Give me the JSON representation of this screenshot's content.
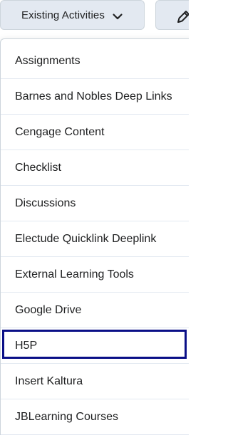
{
  "toolbar": {
    "existing_activities_label": "Existing Activities",
    "existing_activities_icon": "chevron-down-icon",
    "second_button_icon": "pencil-icon"
  },
  "menu": {
    "focused_item": "H5P",
    "items": [
      {
        "label": "Assignments"
      },
      {
        "label": "Barnes and Nobles Deep Links"
      },
      {
        "label": "Cengage Content"
      },
      {
        "label": "Checklist"
      },
      {
        "label": "Discussions"
      },
      {
        "label": "Electude Quicklink Deeplink"
      },
      {
        "label": "External Learning Tools"
      },
      {
        "label": "Google Drive"
      },
      {
        "label": "H5P"
      },
      {
        "label": "Insert Kaltura"
      },
      {
        "label": "JBLearning Courses"
      }
    ]
  },
  "colors": {
    "button_bg": "#e3e9f1",
    "border": "#cdd5dc",
    "focus_ring": "#0a0f87",
    "text": "#202122"
  }
}
